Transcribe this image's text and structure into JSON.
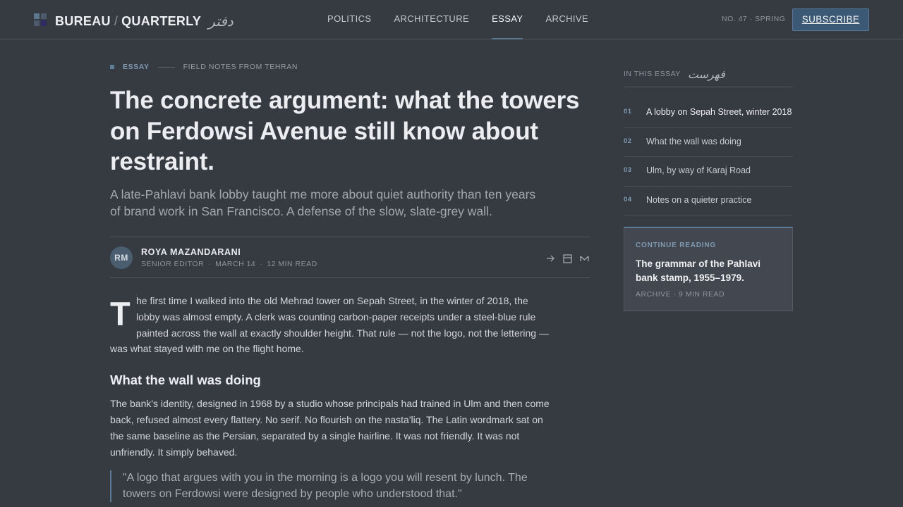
{
  "header": {
    "brand_left": "BUREAU",
    "brand_sep": "/",
    "brand_right": "QUARTERLY",
    "brand_farsi": "دفتر",
    "nav": [
      {
        "label": "POLITICS",
        "active": false
      },
      {
        "label": "ARCHITECTURE",
        "active": false
      },
      {
        "label": "ESSAY",
        "active": true
      },
      {
        "label": "ARCHIVE",
        "active": false
      }
    ],
    "issue": "NO. 47 · SPRING",
    "subscribe_label": "SUBSCRIBE"
  },
  "article": {
    "kicker_label": "ESSAY",
    "kicker_series": "FIELD NOTES FROM TEHRAN",
    "title": "The concrete argument: what the towers on Ferdowsi Avenue still know about restraint.",
    "dek": "A late-Pahlavi bank lobby taught me more about quiet authority than ten years of brand work in San Francisco. A defense of the slow, slate-grey wall.",
    "author_initials": "RM",
    "author_name": "ROYA MAZANDARANI",
    "author_role": "SENIOR EDITOR",
    "date": "MARCH 14",
    "read_time": "12 MIN READ",
    "share_icons": [
      "arrow-right-icon",
      "bookmark-icon",
      "mail-icon"
    ],
    "dropcap": "T",
    "p1": "he first time I walked into the old Mehrad tower on Sepah Street, in the winter of 2018, the lobby was almost empty. A clerk was counting carbon-paper receipts under a steel-blue rule painted across the wall at exactly shoulder height. That rule — not the logo, not the lettering — was what stayed with me on the flight home.",
    "h2": "What the wall was doing",
    "p2": "The bank's identity, designed in 1968 by a studio whose principals had trained in Ulm and then come back, refused almost every flattery. No serif. No flourish on the nasta'liq. The Latin wordmark sat on the same baseline as the Persian, separated by a single hairline. It was not friendly. It was not unfriendly. It simply behaved.",
    "quote": "\"A logo that argues with you in the morning is a logo you will resent by lunch. The towers on Ferdowsi were designed by people who understood that.\""
  },
  "sidebar": {
    "toc_label": "IN THIS ESSAY",
    "toc_farsi": "فهرست",
    "toc": [
      {
        "num": "01",
        "text": "A lobby on Sepah Street, winter 2018",
        "active": true
      },
      {
        "num": "02",
        "text": "What the wall was doing",
        "active": false
      },
      {
        "num": "03",
        "text": "Ulm, by way of Karaj Road",
        "active": false
      },
      {
        "num": "04",
        "text": "Notes on a quieter practice",
        "active": false
      }
    ],
    "card_label": "CONTINUE READING",
    "card_title": "The grammar of the Pahlavi bank stamp, 1955–1979.",
    "card_meta": "ARCHIVE · 9 MIN READ"
  },
  "colors": {
    "background": "#363a41",
    "accent": "#5b7a93",
    "subscribe_bg": "#3b5874"
  }
}
